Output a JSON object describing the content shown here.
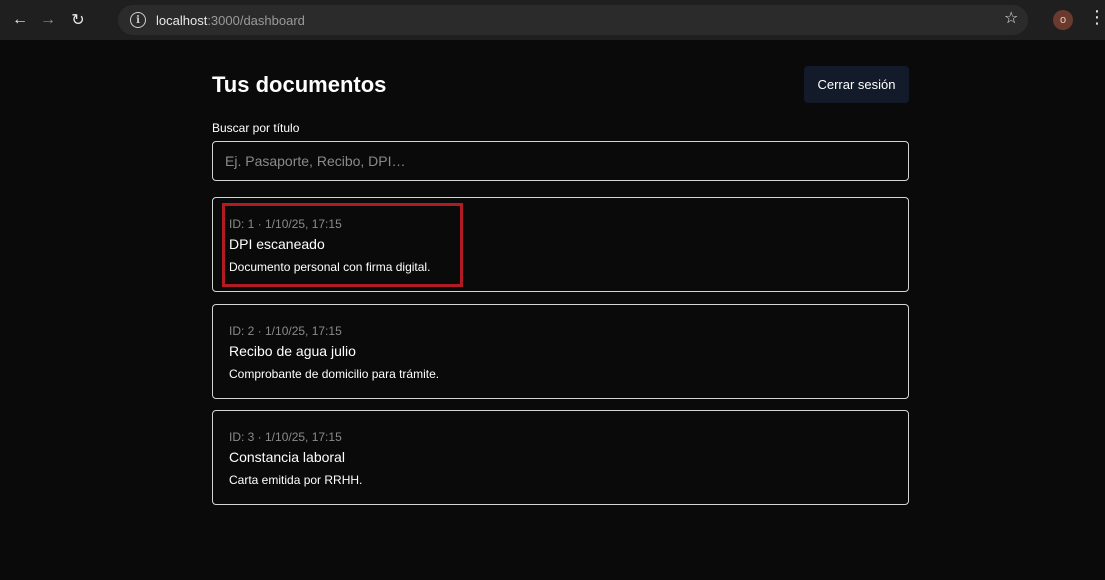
{
  "browser": {
    "url_host": "localhost",
    "url_path": ":3000/dashboard",
    "avatar_letter": "o",
    "icons": {
      "back": "arrow-left-icon",
      "forward": "arrow-right-icon",
      "reload": "reload-icon",
      "info": "info-icon",
      "star": "star-icon",
      "menu": "kebab-menu-icon"
    }
  },
  "page": {
    "title": "Tus documentos",
    "logout_label": "Cerrar sesión"
  },
  "search": {
    "label": "Buscar por título",
    "value": "",
    "placeholder": "Ej. Pasaporte, Recibo, DPI…"
  },
  "documents": [
    {
      "meta": "ID: 1 · 1/10/25, 17:15",
      "title": "DPI escaneado",
      "description": "Documento personal con firma digital."
    },
    {
      "meta": "ID: 2 · 1/10/25, 17:15",
      "title": "Recibo de agua julio",
      "description": "Comprobante de domicilio para trámite."
    },
    {
      "meta": "ID: 3 · 1/10/25, 17:15",
      "title": "Constancia laboral",
      "description": "Carta emitida por RRHH."
    }
  ],
  "colors": {
    "background": "#0a0a0a",
    "card_border": "#d4d4d4",
    "button_bg": "#131a2a",
    "highlight": "#b01c22",
    "muted_text": "#8a8a8a"
  }
}
